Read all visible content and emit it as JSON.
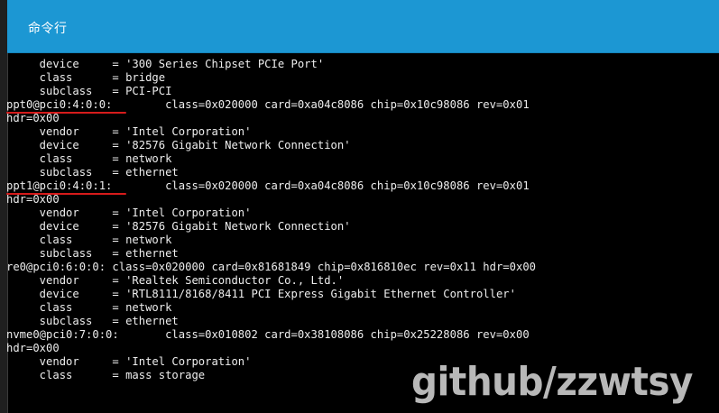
{
  "window": {
    "title": "命令行"
  },
  "terminal": {
    "lines": [
      "     device     = '300 Series Chipset PCIe Port'",
      "     class      = bridge",
      "     subclass   = PCI-PCI",
      "ppt0@pci0:4:0:0:        class=0x020000 card=0xa04c8086 chip=0x10c98086 rev=0x01",
      "hdr=0x00",
      "     vendor     = 'Intel Corporation'",
      "     device     = '82576 Gigabit Network Connection'",
      "     class      = network",
      "     subclass   = ethernet",
      "ppt1@pci0:4:0:1:        class=0x020000 card=0xa04c8086 chip=0x10c98086 rev=0x01",
      "hdr=0x00",
      "     vendor     = 'Intel Corporation'",
      "     device     = '82576 Gigabit Network Connection'",
      "     class      = network",
      "     subclass   = ethernet",
      "re0@pci0:6:0:0: class=0x020000 card=0x81681849 chip=0x816810ec rev=0x11 hdr=0x00",
      "     vendor     = 'Realtek Semiconductor Co., Ltd.'",
      "     device     = 'RTL8111/8168/8411 PCI Express Gigabit Ethernet Controller'",
      "     class      = network",
      "     subclass   = ethernet",
      "nvme0@pci0:7:0:0:       class=0x010802 card=0x38108086 chip=0x25228086 rev=0x00",
      "hdr=0x00",
      "     vendor     = 'Intel Corporation'",
      "     class      = mass storage"
    ]
  },
  "watermark": {
    "text": "github/zzwtsy"
  },
  "colors": {
    "titlebar": "#1c97d3",
    "terminal_bg": "#000000",
    "terminal_text": "#ededed",
    "annotation_underline": "#d61b1b"
  }
}
